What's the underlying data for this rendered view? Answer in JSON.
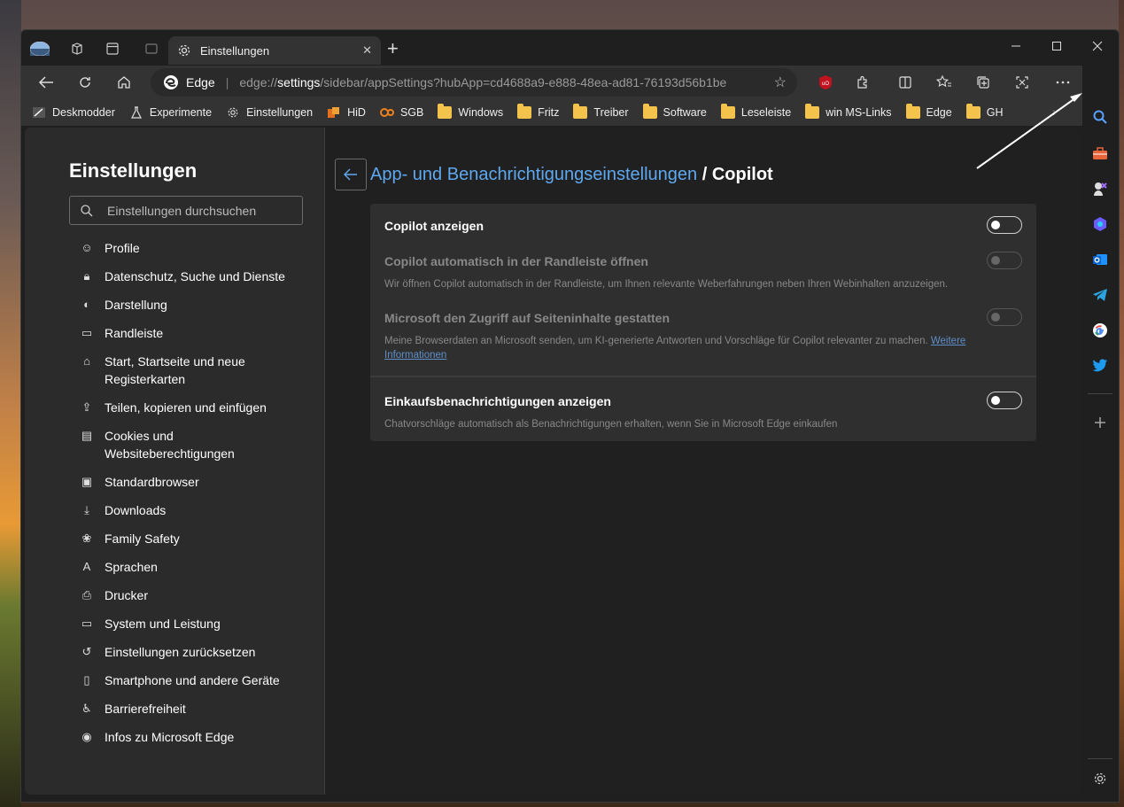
{
  "window": {
    "tab_title": "Einstellungen",
    "new_tab": "+",
    "tab_close": "✕"
  },
  "address": {
    "site": "Edge",
    "separator": "|",
    "url_prefix": "edge://",
    "url_bold": "settings",
    "url_rest": "/sidebar/appSettings?hubApp=cd4688a9-e888-48ea-ad81-76193d56b1be"
  },
  "bookmarks": [
    {
      "label": "Deskmodder",
      "icon": "deskmodder-icon"
    },
    {
      "label": "Experimente",
      "icon": "flask-icon"
    },
    {
      "label": "Einstellungen",
      "icon": "gear-icon"
    },
    {
      "label": "HiD",
      "icon": "hid-icon"
    },
    {
      "label": "SGB",
      "icon": "sgb-icon"
    },
    {
      "label": "Windows",
      "icon": "folder-icon"
    },
    {
      "label": "Fritz",
      "icon": "folder-icon"
    },
    {
      "label": "Treiber",
      "icon": "folder-icon"
    },
    {
      "label": "Software",
      "icon": "folder-icon"
    },
    {
      "label": "Leseleiste",
      "icon": "folder-icon"
    },
    {
      "label": "win MS-Links",
      "icon": "folder-icon"
    },
    {
      "label": "Edge",
      "icon": "folder-icon"
    },
    {
      "label": "GH",
      "icon": "folder-icon"
    }
  ],
  "sidebar": {
    "title": "Einstellungen",
    "search_placeholder": "Einstellungen durchsuchen",
    "items": [
      {
        "label": "Profile",
        "icon": "profile-icon"
      },
      {
        "label": "Datenschutz, Suche und Dienste",
        "icon": "lock-icon"
      },
      {
        "label": "Darstellung",
        "icon": "palette-icon"
      },
      {
        "label": "Randleiste",
        "icon": "sidebar-icon"
      },
      {
        "label": "Start, Startseite und neue",
        "label2": "Registerkarten",
        "icon": "home-icon"
      },
      {
        "label": "Teilen, kopieren und einfügen",
        "icon": "share-icon"
      },
      {
        "label": "Cookies und",
        "label2": "Websiteberechtigungen",
        "icon": "cookie-icon"
      },
      {
        "label": "Standardbrowser",
        "icon": "browser-icon"
      },
      {
        "label": "Downloads",
        "icon": "download-icon"
      },
      {
        "label": "Family Safety",
        "icon": "family-icon"
      },
      {
        "label": "Sprachen",
        "icon": "language-icon"
      },
      {
        "label": "Drucker",
        "icon": "printer-icon"
      },
      {
        "label": "System und Leistung",
        "icon": "laptop-icon"
      },
      {
        "label": "Einstellungen zurücksetzen",
        "icon": "reset-icon"
      },
      {
        "label": "Smartphone und andere Geräte",
        "icon": "phone-icon"
      },
      {
        "label": "Barrierefreiheit",
        "icon": "accessibility-icon"
      },
      {
        "label": "Infos zu Microsoft Edge",
        "icon": "edge-icon"
      }
    ]
  },
  "main": {
    "breadcrumb": "App- und Benachrichtigungseinstellungen",
    "breadcrumb_sep": " / ",
    "current": "Copilot",
    "rows": [
      {
        "title": "Copilot anzeigen",
        "state": "off",
        "enabled": true
      },
      {
        "title": "Copilot automatisch in der Randleiste öffnen",
        "desc": "Wir öffnen Copilot automatisch in der Randleiste, um Ihnen relevante Weberfahrungen neben Ihren Webinhalten anzuzeigen.",
        "state": "off",
        "enabled": false
      },
      {
        "title": "Microsoft den Zugriff auf Seiteninhalte gestatten",
        "desc": "Meine Browserdaten an Microsoft senden, um KI-generierte Antworten und Vorschläge für Copilot relevanter zu machen.",
        "link": "Weitere",
        "link2": "Informationen",
        "state": "off",
        "enabled": false
      },
      {
        "title": "Einkaufsbenachrichtigungen anzeigen",
        "desc": "Chatvorschläge automatisch als Benachrichtigungen erhalten, wenn Sie in Microsoft Edge einkaufen",
        "state": "off",
        "enabled": true
      }
    ]
  },
  "right_sidebar": {
    "icons": [
      "search-icon",
      "toolbox-icon",
      "games-icon",
      "copilot-icon",
      "outlook-icon",
      "telegram-icon",
      "google-icon",
      "twitter-icon",
      "add-icon",
      "settings-icon"
    ]
  },
  "colors": {
    "accent": "#5ea8f0",
    "background": "#202020",
    "panel": "#2f2f2f"
  }
}
